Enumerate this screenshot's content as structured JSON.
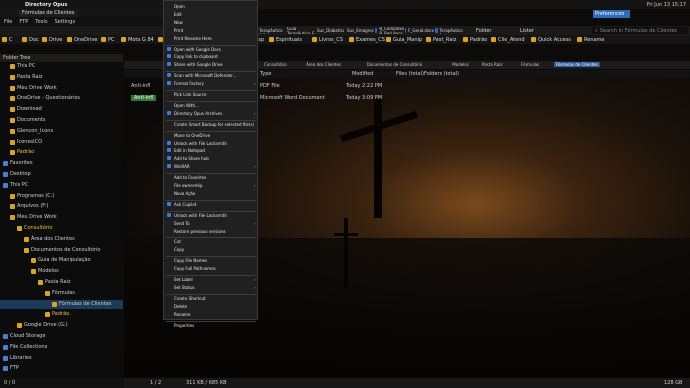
{
  "window": {
    "title": "Directory Opus",
    "clock": "Fri Jun 13 15:17"
  },
  "tabs": {
    "active": "Fórmulas de Clientes",
    "right_label": "Preferences"
  },
  "menubar": [
    "File",
    "FTP",
    "Tools",
    "Settings"
  ],
  "toolbar": {
    "buttons": [
      "Folder",
      "Lister"
    ],
    "search_placeholder": "Search in Fórmulas de Clientes"
  },
  "favorites": [
    "C",
    "Doc",
    "Drive",
    "OneDrive",
    "PC",
    "Moto G 84",
    "Moto E 54",
    "B_Full.docx",
    "Fut_Esp",
    "Espirituais",
    "Livros_CS",
    "Exames_CS",
    "Guia_Manip",
    "Past_Raiz",
    "Padrão",
    "Clie_Atend",
    "Quick Access",
    "Rename"
  ],
  "top_files": [
    "Guia Terapêutico 2.1.docx",
    "Guia Terapêutico_EM.docx",
    "Suc_Diabetico.docx",
    "Suc_Emagrecimento.docx",
    "B_Complexo B_Red.docx",
    "F_Geral.docx",
    "Guia Terapêutico 1.docx"
  ],
  "tree": {
    "header": "Folder Tree",
    "nodes": [
      {
        "label": "This PC",
        "depth": 1
      },
      {
        "label": "Pasta Raiz",
        "depth": 1
      },
      {
        "label": "Meu Drive Work",
        "depth": 1
      },
      {
        "label": "OneDrive - Questionários",
        "depth": 1
      },
      {
        "label": "Download",
        "depth": 1
      },
      {
        "label": "Documents",
        "depth": 1
      },
      {
        "label": "Glencon_Icons",
        "depth": 1
      },
      {
        "label": "IconesICO",
        "depth": 1
      },
      {
        "label": "Padrão",
        "depth": 1
      },
      {
        "label": "Favorites",
        "depth": 0
      },
      {
        "label": "Desktop",
        "depth": 0
      },
      {
        "label": "This PC",
        "depth": 0
      },
      {
        "label": "Programas (C:)",
        "depth": 1
      },
      {
        "label": "Arquivos (F:)",
        "depth": 1
      },
      {
        "label": "Meu Drive Work",
        "depth": 1
      },
      {
        "label": "Consultório",
        "depth": 2
      },
      {
        "label": "Área dos Clientes",
        "depth": 3
      },
      {
        "label": "Documentos de Consultório",
        "depth": 3
      },
      {
        "label": "Guia de Manipulação",
        "depth": 4
      },
      {
        "label": "Modelos",
        "depth": 4
      },
      {
        "label": "Pasta Raiz",
        "depth": 5
      },
      {
        "label": "Fórmulas",
        "depth": 6
      },
      {
        "label": "Fórmulas de Clientes",
        "depth": 7
      },
      {
        "label": "Padrão",
        "depth": 6
      },
      {
        "label": "Google Drive (G:)",
        "depth": 2
      },
      {
        "label": "Cloud Storage",
        "depth": 0
      },
      {
        "label": "File Collections",
        "depth": 0
      },
      {
        "label": "Libraries",
        "depth": 0
      },
      {
        "label": "FTP",
        "depth": 0
      }
    ]
  },
  "path": [
    "Consultório",
    "Área dos Clientes",
    "Documentos de Consultório",
    "Modelos",
    "Pasta Raiz",
    "Fórmulas",
    "Fórmulas de Clientes"
  ],
  "columns": [
    "Type",
    "Modified",
    "Files (total)",
    "Folders (total)"
  ],
  "files": [
    {
      "name": "Anti-infl",
      "type": "PDF File",
      "modified": "Today 2:22 PM"
    },
    {
      "name": "Anti-infl",
      "type": "Microsoft Word Document",
      "modified": "Today 3:09 PM"
    }
  ],
  "status": {
    "left": "0 / 0",
    "middle": "1 / 2",
    "sizes": "311 KB / 685 KB",
    "right": "128 GB"
  },
  "context_menu": [
    {
      "label": "Open",
      "icon": "none",
      "arrow": false
    },
    {
      "label": "Edit",
      "icon": "none",
      "arrow": false
    },
    {
      "label": "New",
      "icon": "none",
      "arrow": false
    },
    {
      "label": "Print",
      "icon": "none",
      "arrow": false
    },
    {
      "label": "Print Rename Here",
      "icon": "none",
      "arrow": false
    },
    {
      "sep": true
    },
    {
      "label": "Open with Google Docs",
      "icon": "google-docs-icon",
      "arrow": false
    },
    {
      "label": "Copy link to clipboard",
      "icon": "google-drive-icon",
      "arrow": false
    },
    {
      "label": "Share with Google Drive",
      "icon": "google-drive-icon",
      "arrow": false
    },
    {
      "sep": true
    },
    {
      "label": "Scan with Microsoft Defender...",
      "icon": "defender-icon",
      "arrow": false
    },
    {
      "label": "Format Factory",
      "icon": "format-factory-icon",
      "arrow": true
    },
    {
      "sep": true
    },
    {
      "label": "Pick Link Source",
      "icon": "none",
      "arrow": false
    },
    {
      "sep": true
    },
    {
      "label": "Open With...",
      "icon": "none",
      "arrow": false
    },
    {
      "label": "Directory Opus Archives",
      "icon": "archive-icon",
      "arrow": true
    },
    {
      "sep": true
    },
    {
      "label": "Create Smart Backup for selected file(s)",
      "icon": "none",
      "arrow": false
    },
    {
      "sep": true
    },
    {
      "label": "Move to OneDrive",
      "icon": "none",
      "arrow": false
    },
    {
      "label": "Unlock with File Locksmith",
      "icon": "lock-icon",
      "arrow": false
    },
    {
      "label": "Edit in Notepad",
      "icon": "notepad-icon",
      "arrow": false
    },
    {
      "label": "Add to Share hub",
      "icon": "share-icon",
      "arrow": false
    },
    {
      "label": "WinRAR",
      "icon": "winrar-icon",
      "arrow": true
    },
    {
      "sep": true
    },
    {
      "label": "Add to Favorites",
      "icon": "none",
      "arrow": false
    },
    {
      "label": "File ownership",
      "icon": "none",
      "arrow": true
    },
    {
      "label": "Nova Ação",
      "icon": "none",
      "arrow": false
    },
    {
      "sep": true
    },
    {
      "label": "Ask Copilot",
      "icon": "copilot-icon",
      "arrow": false
    },
    {
      "sep": true
    },
    {
      "label": "Unlock with File Locksmith",
      "icon": "lock-icon",
      "arrow": false
    },
    {
      "label": "Send To",
      "icon": "none",
      "arrow": true
    },
    {
      "label": "Restore previous versions",
      "icon": "none",
      "arrow": false
    },
    {
      "sep": true
    },
    {
      "label": "Cut",
      "icon": "none",
      "arrow": false
    },
    {
      "label": "Copy",
      "icon": "none",
      "arrow": false
    },
    {
      "sep": true
    },
    {
      "label": "Copy File Names",
      "icon": "none",
      "arrow": false
    },
    {
      "label": "Copy Full Pathnames",
      "icon": "none",
      "arrow": false
    },
    {
      "sep": true
    },
    {
      "label": "Set Label",
      "icon": "none",
      "arrow": true
    },
    {
      "label": "Set Status",
      "icon": "none",
      "arrow": true
    },
    {
      "sep": true
    },
    {
      "label": "Create Shortcut",
      "icon": "none",
      "arrow": false
    },
    {
      "label": "Delete",
      "icon": "none",
      "arrow": false
    },
    {
      "label": "Rename",
      "icon": "none",
      "arrow": false
    },
    {
      "sep": true
    },
    {
      "label": "Properties",
      "icon": "none",
      "arrow": false
    }
  ]
}
